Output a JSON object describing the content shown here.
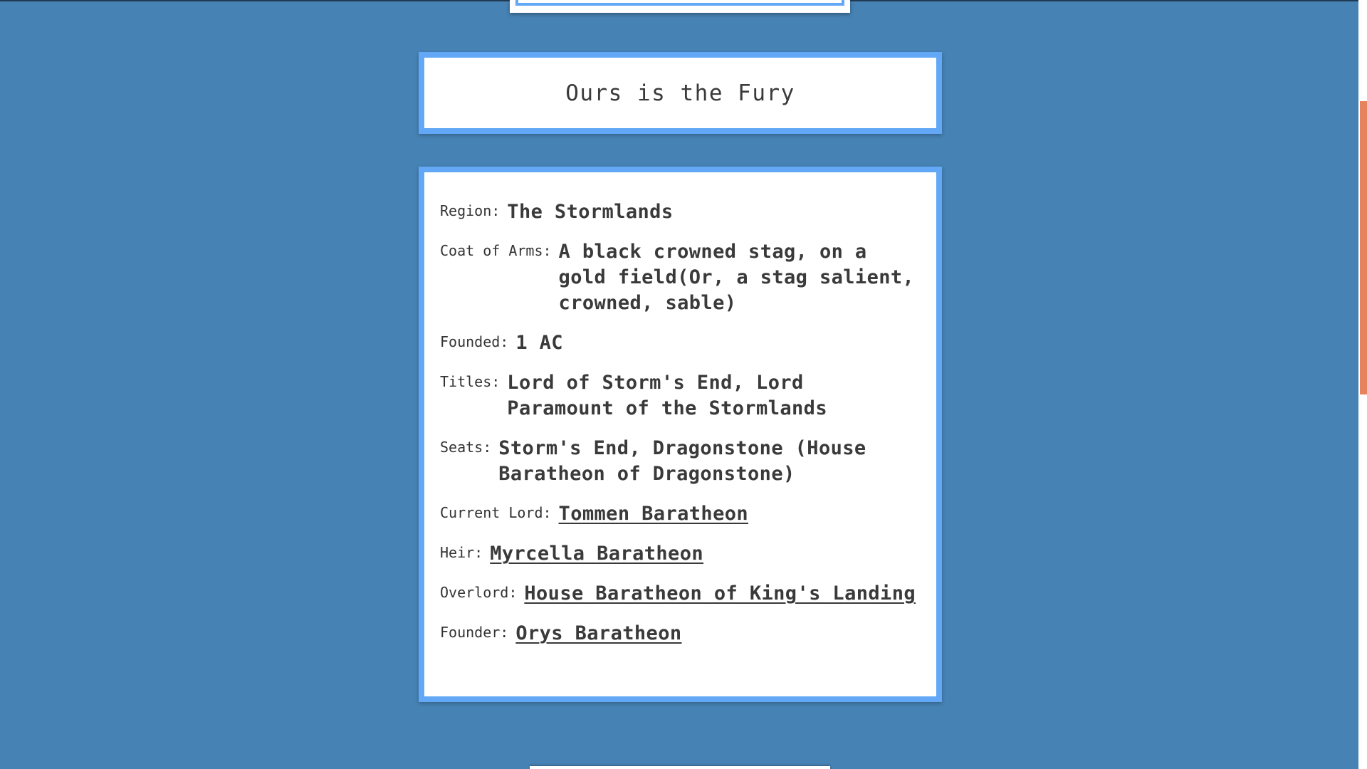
{
  "words": "Ours is the Fury",
  "info": {
    "region": {
      "label": "Region:",
      "value": "The Stormlands"
    },
    "coat_of_arms": {
      "label": "Coat of Arms:",
      "value": "A black crowned stag, on a gold field(Or, a stag salient, crowned, sable)"
    },
    "founded": {
      "label": "Founded:",
      "value": "1 AC"
    },
    "titles": {
      "label": "Titles:",
      "value": "Lord of Storm's End, Lord Paramount of the Stormlands"
    },
    "seats": {
      "label": "Seats:",
      "value": "Storm's End, Dragonstone (House Baratheon of Dragonstone)"
    },
    "current_lord": {
      "label": "Current Lord:",
      "value": "Tommen Baratheon"
    },
    "heir": {
      "label": "Heir:",
      "value": "Myrcella Baratheon"
    },
    "overlord": {
      "label": "Overlord:",
      "value": "House Baratheon of King's Landing"
    },
    "founder": {
      "label": "Founder:",
      "value": "Orys Baratheon"
    }
  },
  "colors": {
    "background": "#4682b4",
    "card_border": "#62a8f7",
    "scrollbar_thumb": "#e8835f"
  }
}
